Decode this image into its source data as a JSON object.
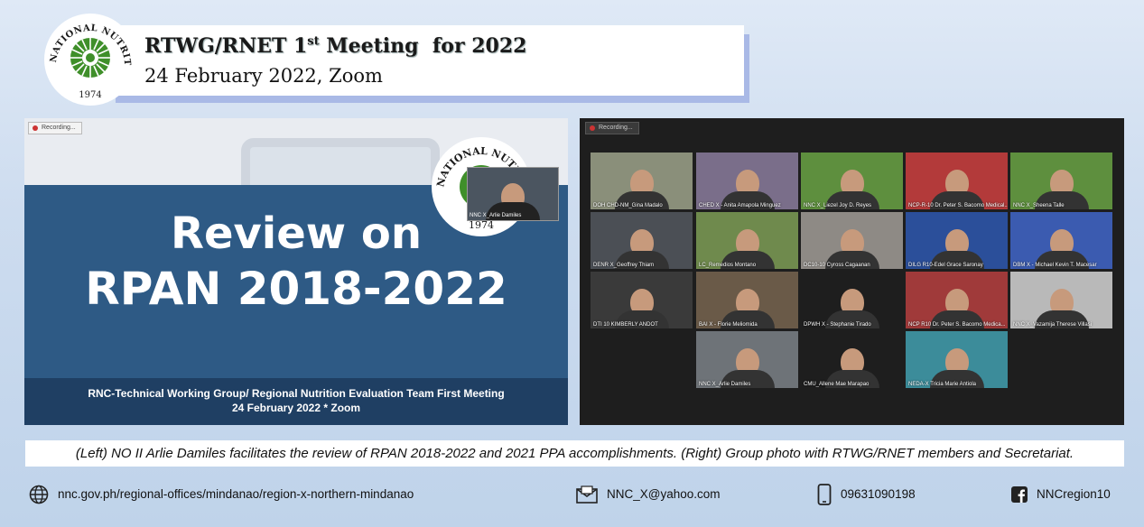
{
  "header": {
    "title_prefix": "RTWG/RNET 1",
    "title_sup": "st",
    "title_suffix": " Meeting  for 2022",
    "subtitle": "24 February 2022, Zoom",
    "logo_text": "NATIONAL NUTRITION COUNCIL",
    "logo_year": "1974"
  },
  "left_panel": {
    "recording_label": "Recording...",
    "slide_title_line1": "Review on",
    "slide_title_line2": "RPAN 2018-2022",
    "footer_line1": "RNC-Technical Working Group/ Regional Nutrition Evaluation Team First Meeting",
    "footer_line2": "24 February 2022 * Zoom",
    "logo_text": "NATIONAL NUTRITION",
    "logo_year": "1974",
    "presenter_label": "NNC X_Arlie Damiles"
  },
  "right_panel": {
    "recording_label": "Recording...",
    "participants": [
      {
        "name": "DOH CHD-NM_Gina Madalo",
        "bg": "#8a8f7a"
      },
      {
        "name": "CHED X - Anita Amapola Minguez",
        "bg": "#7a6e8a"
      },
      {
        "name": "NNC X_Liezel Joy D. Reyes",
        "bg": "#5e8f3e"
      },
      {
        "name": "NCP-R-10 Dr. Peter S. Bacomo Medical...",
        "bg": "#b33a3a"
      },
      {
        "name": "NNC X_Sheena Talle",
        "bg": "#5e8f3e"
      },
      {
        "name": "DENR X_Geoffrey Thiam",
        "bg": "#4b4f55"
      },
      {
        "name": "LC_Remedios Montano",
        "bg": "#6f8a4d"
      },
      {
        "name": "DC10-10 Cyross Cagaanan",
        "bg": "#8e8a85"
      },
      {
        "name": "DILG R10-Edel Grace Saronay",
        "bg": "#2b4f9a"
      },
      {
        "name": "DBM X - Michael Kevin T. Macesar",
        "bg": "#3b5bb0"
      },
      {
        "name": "DTI 10 KIMBERLY ANDOT",
        "bg": "#3a3a3a"
      },
      {
        "name": "BAI X - Florie Meliomida",
        "bg": "#6a5a48"
      },
      {
        "name": "DPWH X - Stephanie Tirado",
        "bg": "#1e1e1e"
      },
      {
        "name": "NCP R10 Dr. Peter S. Bacomo Medica...",
        "bg": "#a03a3a"
      },
      {
        "name": "NNC X_Vazamija Therese Villasi",
        "bg": "#b9b9b9"
      },
      {
        "name": "NNC X_Arlie Damiles",
        "bg": "#6e7378"
      },
      {
        "name": "CMU_Allene Mae Marapao",
        "bg": "#1e1e1e"
      },
      {
        "name": "NEDA-X Tricia Marie Antiola",
        "bg": "#3c8c9a"
      }
    ]
  },
  "caption": "(Left) NO II Arlie Damiles facilitates the review of RPAN 2018-2022 and 2021 PPA accomplishments. (Right) Group photo with RTWG/RNET members and Secretariat.",
  "footer": {
    "website": "nnc.gov.ph/regional-offices/mindanao/region-x-northern-mindanao",
    "email": "NNC_X@yahoo.com",
    "phone": "09631090198",
    "facebook": "NNCregion10"
  },
  "colors": {
    "slide_band": "#2e5a85",
    "slide_footer": "#1f3f63",
    "header_shadow": "#a9b9e6",
    "logo_green": "#3f8f2a"
  }
}
